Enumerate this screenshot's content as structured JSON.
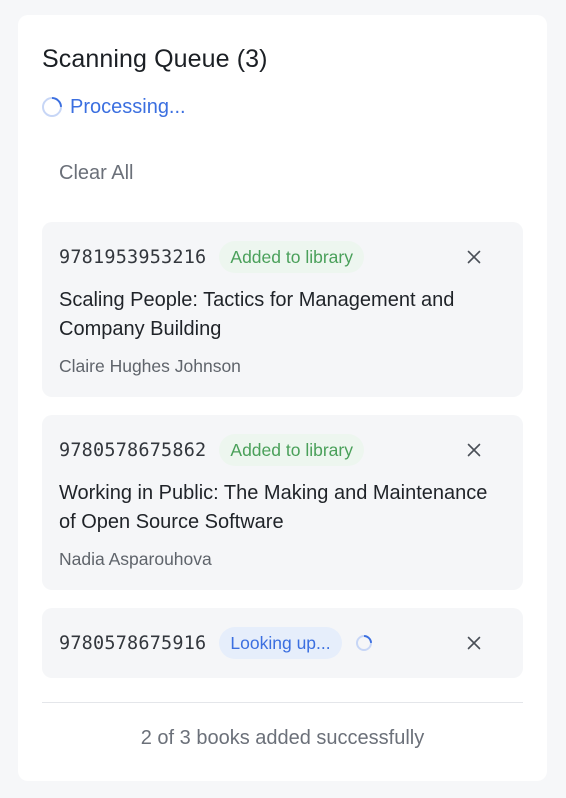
{
  "queue": {
    "title": "Scanning Queue (3)",
    "status_text": "Processing...",
    "clear_all_label": "Clear All",
    "items": [
      {
        "isbn": "9781953953216",
        "status": "Added to library",
        "title": "Scaling People: Tactics for Management and Company Building",
        "author": "Claire Hughes Johnson"
      },
      {
        "isbn": "9780578675862",
        "status": "Added to library",
        "title": "Working in Public: The Making and Maintenance of Open Source Software",
        "author": "Nadia Asparouhova"
      },
      {
        "isbn": "9780578675916",
        "status": "Looking up..."
      }
    ],
    "summary": "2 of 3 books added successfully"
  },
  "icons": {
    "status_spinner": "spinner-icon",
    "remove": "close-icon"
  },
  "colors": {
    "accent": "#3b6fe0",
    "success_text": "#4aa05a",
    "success_bg": "#edf6ef",
    "pending_bg": "#e6eefb"
  }
}
